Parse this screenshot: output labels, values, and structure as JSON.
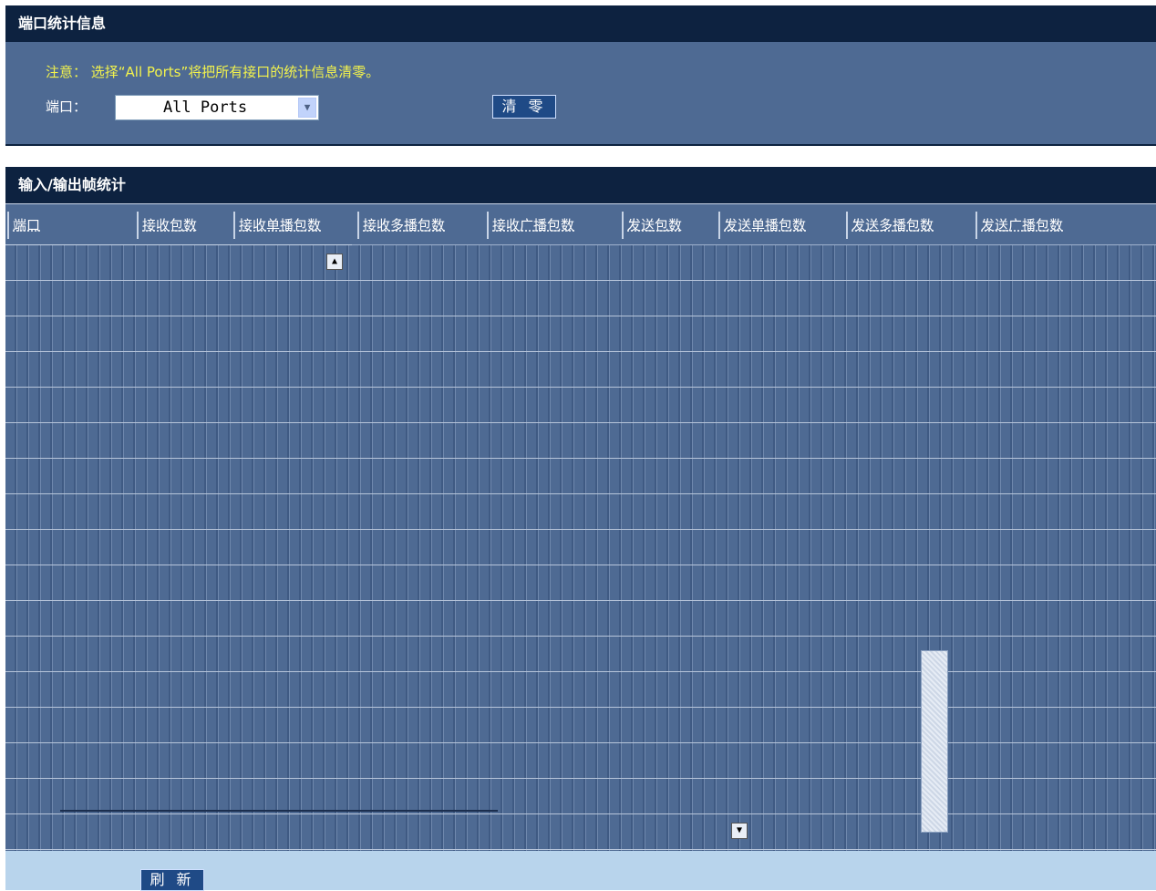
{
  "port_stats_panel": {
    "title": "端口统计信息",
    "notice": "注意： 选择“All Ports”将把所有接口的统计信息清零。",
    "port_label": "端口：",
    "port_select": {
      "selected": "All Ports"
    },
    "clear_button": "清 零"
  },
  "frame_stats_panel": {
    "title": "输入/输出帧统计",
    "columns": [
      "端口",
      "接收包数",
      "接收单播包数",
      "接收多播包数",
      "接收广播包数",
      "发送包数",
      "发送单播包数",
      "发送多播包数",
      "发送广播包数"
    ]
  },
  "footer": {
    "refresh_button": "刷 新"
  },
  "icons": {
    "select_arrow": "chevron-down-icon",
    "scroll_up": "arrow-up-icon",
    "scroll_down": "arrow-down-icon"
  },
  "colors": {
    "header_bg": "#0d2240",
    "panel_bg": "#4e6a93",
    "notice_text": "#f3f34c",
    "footer_bg": "#b8d4ec",
    "button_bg": "#1f4a86"
  }
}
